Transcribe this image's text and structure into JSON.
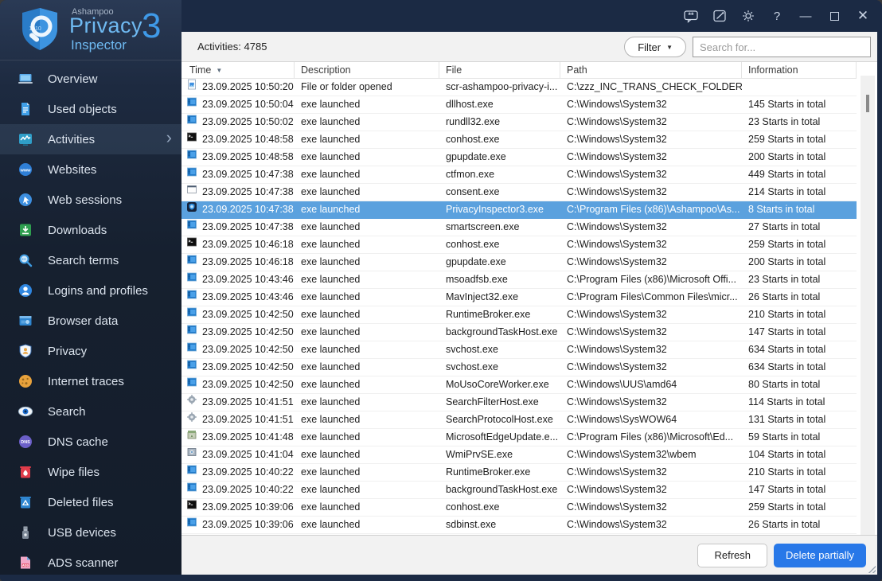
{
  "titlebar": {
    "icons": [
      "feedback",
      "notes",
      "settings",
      "help",
      "minimize",
      "maximize",
      "close"
    ]
  },
  "sidebar": {
    "brand": {
      "company": "Ashampoo",
      "line1": "Privacy",
      "line2": "Inspector",
      "version": "3"
    },
    "items": [
      {
        "label": "Overview",
        "icon": "overview",
        "selected": false
      },
      {
        "label": "Used objects",
        "icon": "used-objects",
        "selected": false
      },
      {
        "label": "Activities",
        "icon": "activities",
        "selected": true
      },
      {
        "label": "Websites",
        "icon": "websites",
        "selected": false
      },
      {
        "label": "Web sessions",
        "icon": "web-sessions",
        "selected": false
      },
      {
        "label": "Downloads",
        "icon": "downloads",
        "selected": false
      },
      {
        "label": "Search terms",
        "icon": "search-terms",
        "selected": false
      },
      {
        "label": "Logins and profiles",
        "icon": "logins",
        "selected": false
      },
      {
        "label": "Browser data",
        "icon": "browser-data",
        "selected": false
      },
      {
        "label": "Privacy",
        "icon": "privacy",
        "selected": false
      },
      {
        "label": "Internet traces",
        "icon": "internet-traces",
        "selected": false
      },
      {
        "label": "Search",
        "icon": "search",
        "selected": false
      },
      {
        "label": "DNS cache",
        "icon": "dns-cache",
        "selected": false
      },
      {
        "label": "Wipe files",
        "icon": "wipe-files",
        "selected": false
      },
      {
        "label": "Deleted files",
        "icon": "deleted-files",
        "selected": false
      },
      {
        "label": "USB devices",
        "icon": "usb-devices",
        "selected": false
      },
      {
        "label": "ADS scanner",
        "icon": "ads-scanner",
        "selected": false
      }
    ]
  },
  "toolbar": {
    "count_label": "Activities: 4785",
    "filter_label": "Filter",
    "search_placeholder": "Search for..."
  },
  "table": {
    "columns": [
      "Time",
      "Description",
      "File",
      "Path",
      "Information"
    ],
    "rows": [
      {
        "icon": "file",
        "time": "23.09.2025 10:50:20",
        "description": "File or folder opened",
        "file": "scr-ashampoo-privacy-i...",
        "path": "C:\\zzz_INC_TRANS_CHECK_FOLDER",
        "information": "",
        "selected": false
      },
      {
        "icon": "exe",
        "time": "23.09.2025 10:50:04",
        "description": "exe launched",
        "file": "dllhost.exe",
        "path": "C:\\Windows\\System32",
        "information": "145 Starts in total",
        "selected": false
      },
      {
        "icon": "exe",
        "time": "23.09.2025 10:50:02",
        "description": "exe launched",
        "file": "rundll32.exe",
        "path": "C:\\Windows\\System32",
        "information": "23 Starts in total",
        "selected": false
      },
      {
        "icon": "console",
        "time": "23.09.2025 10:48:58",
        "description": "exe launched",
        "file": "conhost.exe",
        "path": "C:\\Windows\\System32",
        "information": "259 Starts in total",
        "selected": false
      },
      {
        "icon": "exe",
        "time": "23.09.2025 10:48:58",
        "description": "exe launched",
        "file": "gpupdate.exe",
        "path": "C:\\Windows\\System32",
        "information": "200 Starts in total",
        "selected": false
      },
      {
        "icon": "exe",
        "time": "23.09.2025 10:47:38",
        "description": "exe launched",
        "file": "ctfmon.exe",
        "path": "C:\\Windows\\System32",
        "information": "449 Starts in total",
        "selected": false
      },
      {
        "icon": "window",
        "time": "23.09.2025 10:47:38",
        "description": "exe launched",
        "file": "consent.exe",
        "path": "C:\\Windows\\System32",
        "information": "214 Starts in total",
        "selected": false
      },
      {
        "icon": "app",
        "time": "23.09.2025 10:47:38",
        "description": "exe launched",
        "file": "PrivacyInspector3.exe",
        "path": "C:\\Program Files (x86)\\Ashampoo\\As...",
        "information": "8 Starts in total",
        "selected": true
      },
      {
        "icon": "exe",
        "time": "23.09.2025 10:47:38",
        "description": "exe launched",
        "file": "smartscreen.exe",
        "path": "C:\\Windows\\System32",
        "information": "27 Starts in total",
        "selected": false
      },
      {
        "icon": "console",
        "time": "23.09.2025 10:46:18",
        "description": "exe launched",
        "file": "conhost.exe",
        "path": "C:\\Windows\\System32",
        "information": "259 Starts in total",
        "selected": false
      },
      {
        "icon": "exe",
        "time": "23.09.2025 10:46:18",
        "description": "exe launched",
        "file": "gpupdate.exe",
        "path": "C:\\Windows\\System32",
        "information": "200 Starts in total",
        "selected": false
      },
      {
        "icon": "exe",
        "time": "23.09.2025 10:43:46",
        "description": "exe launched",
        "file": "msoadfsb.exe",
        "path": "C:\\Program Files (x86)\\Microsoft Offi...",
        "information": "23 Starts in total",
        "selected": false
      },
      {
        "icon": "exe",
        "time": "23.09.2025 10:43:46",
        "description": "exe launched",
        "file": "MavInject32.exe",
        "path": "C:\\Program Files\\Common Files\\micr...",
        "information": "26 Starts in total",
        "selected": false
      },
      {
        "icon": "exe",
        "time": "23.09.2025 10:42:50",
        "description": "exe launched",
        "file": "RuntimeBroker.exe",
        "path": "C:\\Windows\\System32",
        "information": "210 Starts in total",
        "selected": false
      },
      {
        "icon": "exe",
        "time": "23.09.2025 10:42:50",
        "description": "exe launched",
        "file": "backgroundTaskHost.exe",
        "path": "C:\\Windows\\System32",
        "information": "147 Starts in total",
        "selected": false
      },
      {
        "icon": "exe",
        "time": "23.09.2025 10:42:50",
        "description": "exe launched",
        "file": "svchost.exe",
        "path": "C:\\Windows\\System32",
        "information": "634 Starts in total",
        "selected": false
      },
      {
        "icon": "exe",
        "time": "23.09.2025 10:42:50",
        "description": "exe launched",
        "file": "svchost.exe",
        "path": "C:\\Windows\\System32",
        "information": "634 Starts in total",
        "selected": false
      },
      {
        "icon": "exe",
        "time": "23.09.2025 10:42:50",
        "description": "exe launched",
        "file": "MoUsoCoreWorker.exe",
        "path": "C:\\Windows\\UUS\\amd64",
        "information": "80 Starts in total",
        "selected": false
      },
      {
        "icon": "gear",
        "time": "23.09.2025 10:41:51",
        "description": "exe launched",
        "file": "SearchFilterHost.exe",
        "path": "C:\\Windows\\System32",
        "information": "114 Starts in total",
        "selected": false
      },
      {
        "icon": "gear",
        "time": "23.09.2025 10:41:51",
        "description": "exe launched",
        "file": "SearchProtocolHost.exe",
        "path": "C:\\Windows\\SysWOW64",
        "information": "131 Starts in total",
        "selected": false
      },
      {
        "icon": "installer",
        "time": "23.09.2025 10:41:48",
        "description": "exe launched",
        "file": "MicrosoftEdgeUpdate.e...",
        "path": "C:\\Program Files (x86)\\Microsoft\\Ed...",
        "information": "59 Starts in total",
        "selected": false
      },
      {
        "icon": "wmi",
        "time": "23.09.2025 10:41:04",
        "description": "exe launched",
        "file": "WmiPrvSE.exe",
        "path": "C:\\Windows\\System32\\wbem",
        "information": "104 Starts in total",
        "selected": false
      },
      {
        "icon": "exe",
        "time": "23.09.2025 10:40:22",
        "description": "exe launched",
        "file": "RuntimeBroker.exe",
        "path": "C:\\Windows\\System32",
        "information": "210 Starts in total",
        "selected": false
      },
      {
        "icon": "exe",
        "time": "23.09.2025 10:40:22",
        "description": "exe launched",
        "file": "backgroundTaskHost.exe",
        "path": "C:\\Windows\\System32",
        "information": "147 Starts in total",
        "selected": false
      },
      {
        "icon": "console",
        "time": "23.09.2025 10:39:06",
        "description": "exe launched",
        "file": "conhost.exe",
        "path": "C:\\Windows\\System32",
        "information": "259 Starts in total",
        "selected": false
      },
      {
        "icon": "exe",
        "time": "23.09.2025 10:39:06",
        "description": "exe launched",
        "file": "sdbinst.exe",
        "path": "C:\\Windows\\System32",
        "information": "26 Starts in total",
        "selected": false
      }
    ]
  },
  "footer": {
    "refresh_label": "Refresh",
    "delete_label": "Delete partially"
  },
  "colors": {
    "titlebar_bg": "#1b2a44",
    "sidebar_bg": "#18233a",
    "accent_blue": "#3f9ae8",
    "selected_row": "#5ba1de",
    "delete_button": "#2878e8",
    "toolbar_bg": "#f2f2f2"
  }
}
